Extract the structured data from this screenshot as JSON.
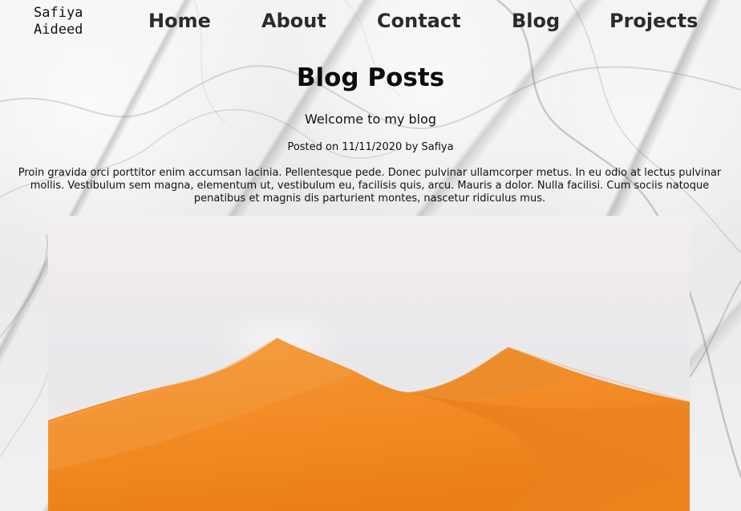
{
  "site": {
    "brand_lines": [
      "Safiya",
      "Aideed"
    ]
  },
  "navigation": {
    "items": [
      {
        "label": "Home"
      },
      {
        "label": "About"
      },
      {
        "label": "Contact"
      },
      {
        "label": "Blog"
      },
      {
        "label": "Projects"
      }
    ]
  },
  "page": {
    "title": "Blog Posts"
  },
  "post": {
    "title": "Welcome to my blog",
    "meta": "Posted on 11/11/2020 by Safiya",
    "body": "Proin gravida orci porttitor enim accumsan lacinia. Pellentesque pede. Donec pulvinar ullamcorper metus. In eu odio at lectus pulvinar mollis. Vestibulum sem magna, elementum ut, vestibulum eu, facilisis quis, arcu. Mauris a dolor. Nulla facilisi. Cum sociis natoque penatibus et magnis dis parturient montes, nascetur ridiculus mus."
  },
  "visuals": {
    "background": "marble",
    "image": "orange desert dunes",
    "accent_colors": {
      "sky": "#f4eff2",
      "dune": "#f08a24",
      "dune_shadow": "#d26b16"
    }
  }
}
